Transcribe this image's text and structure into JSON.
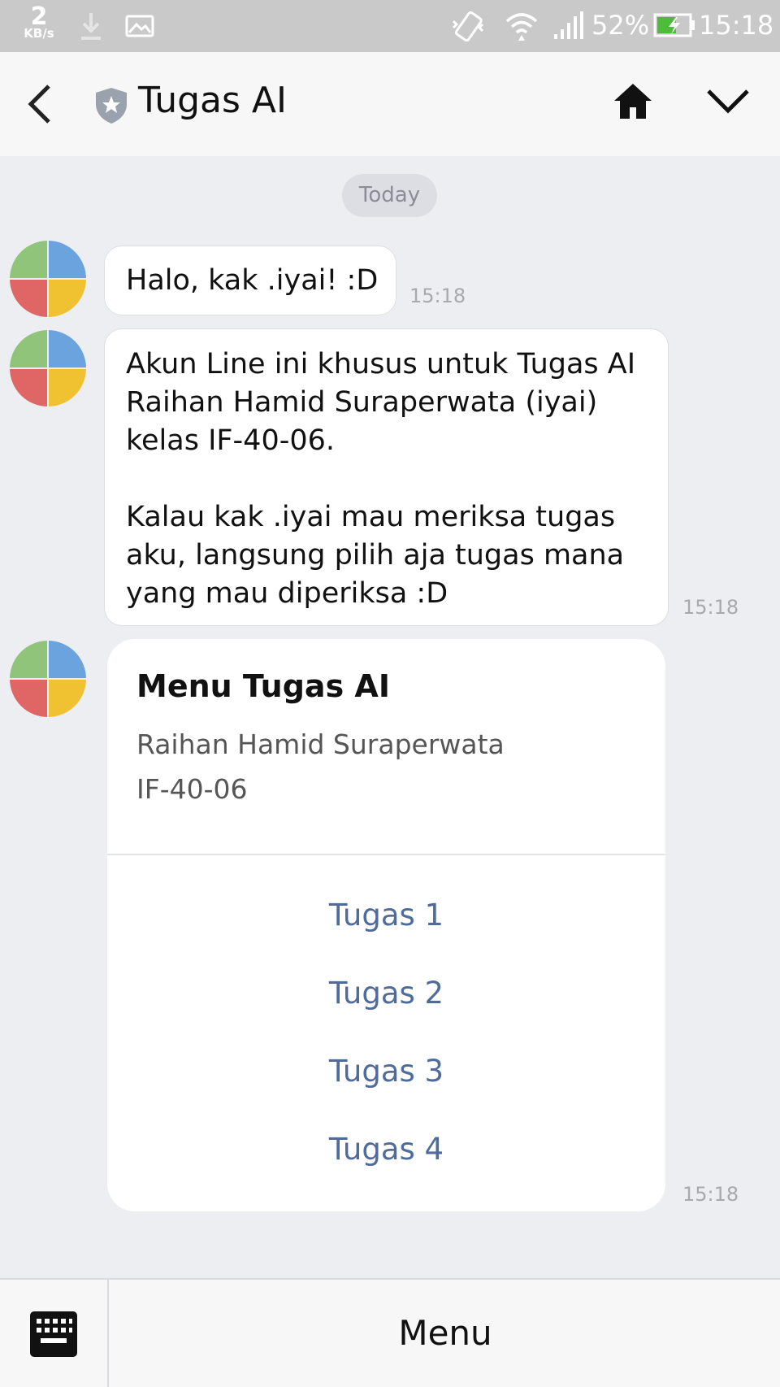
{
  "status_bar": {
    "net_speed_value": "2",
    "net_speed_unit": "KB/s",
    "battery_percent": "52%",
    "time": "15:18",
    "icons": [
      "download-icon",
      "image-icon",
      "vibrate-icon",
      "wifi-icon",
      "signal-icon",
      "battery-charging-icon"
    ]
  },
  "header": {
    "title": "Tugas AI",
    "icons": [
      "back-icon",
      "shield-star-icon",
      "home-icon",
      "chevron-down-icon"
    ]
  },
  "chat": {
    "date_label": "Today",
    "messages": [
      {
        "text": "Halo, kak .iyai! :D",
        "time": "15:18"
      },
      {
        "lines": [
          "Akun Line ini khusus untuk Tugas AI",
          "Raihan Hamid Suraperwata (iyai)",
          "kelas IF-40-06.",
          "",
          "Kalau kak .iyai mau meriksa tugas",
          "aku, langsung pilih aja tugas mana",
          "yang mau diperiksa :D"
        ],
        "time": "15:18"
      }
    ],
    "card": {
      "title": "Menu Tugas AI",
      "subtitle_line1": "Raihan Hamid Suraperwata",
      "subtitle_line2": "IF-40-06",
      "options": [
        "Tugas 1",
        "Tugas 2",
        "Tugas 3",
        "Tugas 4"
      ],
      "time": "15:18"
    }
  },
  "bottom_bar": {
    "menu_label": "Menu",
    "keyboard_icon": "keyboard-icon"
  },
  "colors": {
    "chat_background": "#edeef2",
    "header_background": "#f7f7f7",
    "link_blue": "#4f6b9b",
    "status_bar": "#c9c9c9"
  }
}
